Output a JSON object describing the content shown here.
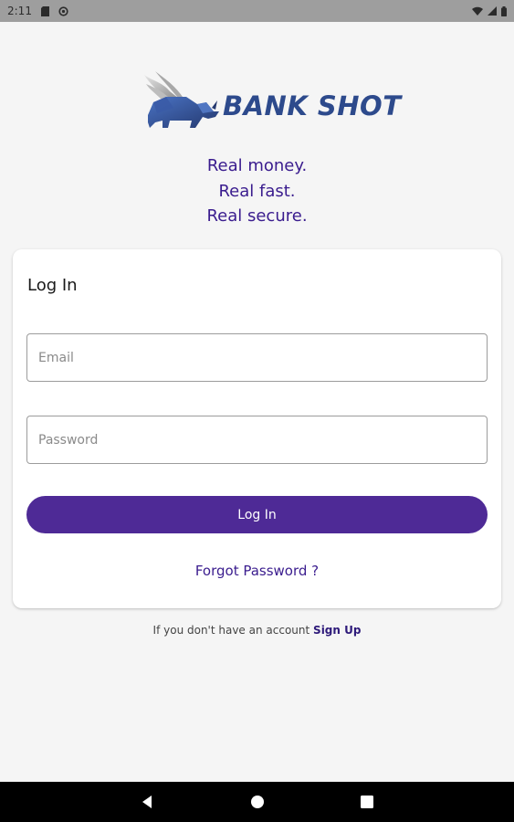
{
  "status_bar": {
    "time": "2:11",
    "icons": [
      "sd-card-icon",
      "sync-icon",
      "wifi-icon",
      "signal-icon",
      "battery-icon"
    ]
  },
  "logo": {
    "text": "BANK SHOT",
    "icon": "winged-rhino-logo"
  },
  "tagline": {
    "lines": [
      "Real money.",
      "Real fast.",
      "Real secure."
    ]
  },
  "login_card": {
    "title": "Log In",
    "email": {
      "placeholder": "Email",
      "value": ""
    },
    "password": {
      "placeholder": "Password",
      "value": ""
    },
    "submit_label": "Log In",
    "forgot_label": "Forgot Password ?"
  },
  "signup": {
    "prompt": "If you don't have an account",
    "link_label": "Sign Up"
  },
  "nav_bar": {
    "buttons": [
      "back-icon",
      "home-icon",
      "recents-icon"
    ]
  },
  "colors": {
    "accent": "#4e2a96",
    "text_purple": "#3a1c8e",
    "logo_blue": "#2d4a8c",
    "background": "#f5f5f5"
  }
}
